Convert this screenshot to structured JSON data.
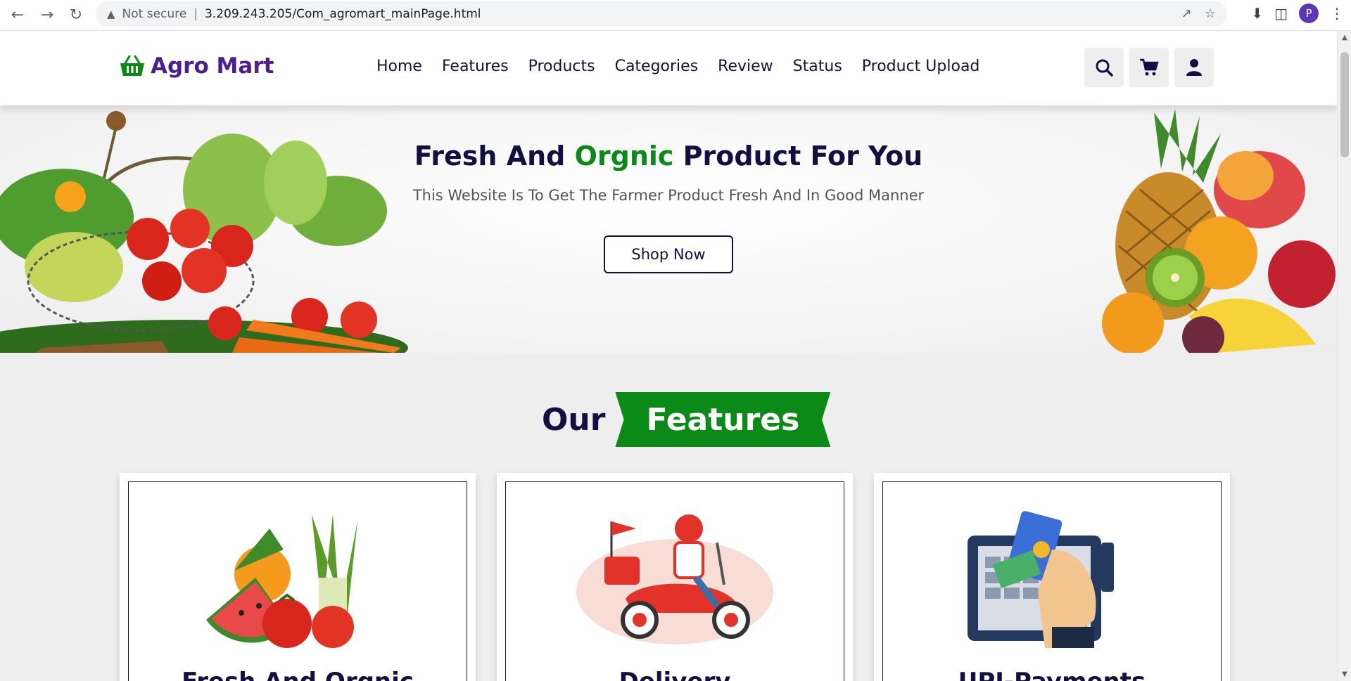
{
  "browser": {
    "security_label": "Not secure",
    "url": "3.209.243.205/Com_agromart_mainPage.html",
    "profile_initial": "P"
  },
  "header": {
    "logo_text": "Agro Mart",
    "nav": [
      "Home",
      "Features",
      "Products",
      "Categories",
      "Review",
      "Status",
      "Product Upload"
    ]
  },
  "hero": {
    "title_part1": "Fresh And ",
    "title_highlight": "Orgnic",
    "title_part2": " Product For You",
    "subtitle": "This Website Is To Get The Farmer Product Fresh And In Good Manner",
    "button": "Shop Now"
  },
  "features": {
    "heading_plain": "Our",
    "heading_highlight": "Features",
    "cards": [
      {
        "title": "Fresh And Orgnic",
        "icon": "vegetables-icon"
      },
      {
        "title": "Delivery",
        "icon": "delivery-scooter-icon"
      },
      {
        "title": "UPI-Payments",
        "icon": "card-payment-icon"
      }
    ]
  },
  "colors": {
    "brand_purple": "#4b1f8f",
    "dark_navy": "#130f40",
    "accent_green": "#0b8a17"
  }
}
